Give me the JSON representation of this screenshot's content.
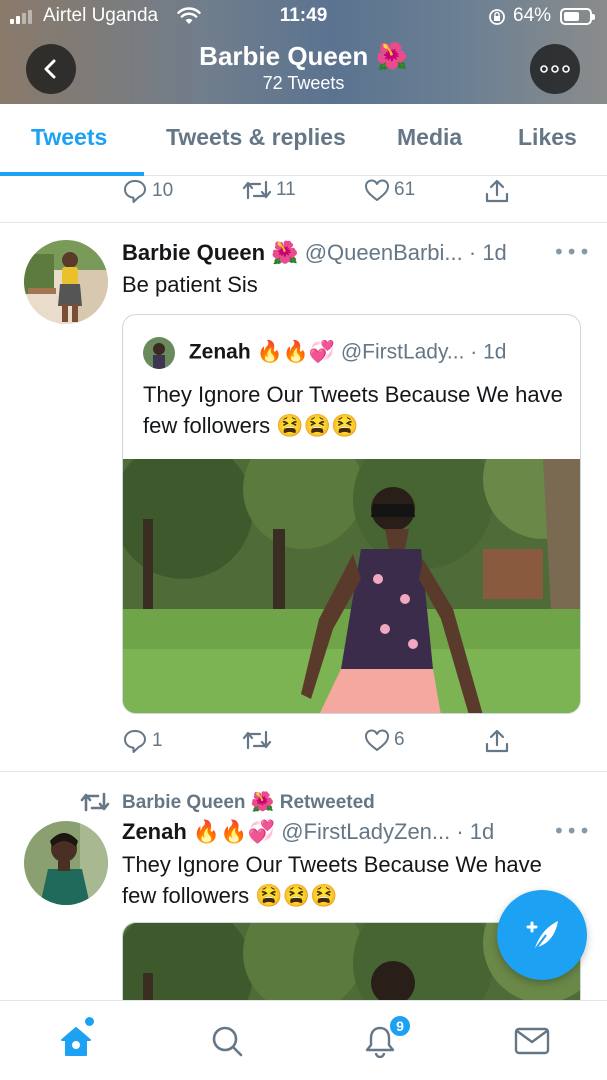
{
  "status_bar": {
    "carrier": "Airtel Uganda",
    "time": "11:49",
    "battery_percent": "64%",
    "battery_level": 0.64
  },
  "profile_header": {
    "name": "Barbie Queen 🌺",
    "tweet_count": "72 Tweets"
  },
  "tabs": [
    {
      "label": "Tweets",
      "active": true
    },
    {
      "label": "Tweets & replies",
      "active": false
    },
    {
      "label": "Media",
      "active": false
    },
    {
      "label": "Likes",
      "active": false
    }
  ],
  "previous_tweet_actions": {
    "replies": "10",
    "retweets": "11",
    "likes": "61"
  },
  "tweet_1": {
    "name": "Barbie Queen 🌺",
    "handle": "@QueenBarbi... · 1d",
    "text": "Be patient Sis",
    "quote": {
      "name": "Zenah 🔥🔥💞",
      "handle": "@FirstLady... · 1d",
      "text": "They Ignore Our Tweets Because We have few followers 😫😫😫"
    },
    "actions": {
      "replies": "1",
      "retweets": "",
      "likes": "6"
    }
  },
  "tweet_2": {
    "retweeted_by": "Barbie Queen 🌺 Retweeted",
    "name": "Zenah 🔥🔥💞",
    "handle": "@FirstLadyZen... · 1d",
    "text": "They Ignore Our Tweets Because We have few followers 😫😫😫"
  },
  "bottom_nav": {
    "notification_badge": "9"
  },
  "icons": {
    "back": "chevron-left-icon",
    "more": "more-horizontal-icon",
    "reply": "reply-icon",
    "retweet": "retweet-icon",
    "like": "heart-icon",
    "share": "share-icon",
    "compose": "compose-feather-icon",
    "home": "home-icon",
    "search": "search-icon",
    "notifications": "bell-icon",
    "messages": "mail-icon"
  },
  "colors": {
    "accent": "#1da1f2",
    "secondary_text": "#657786",
    "primary_text": "#14171a"
  }
}
